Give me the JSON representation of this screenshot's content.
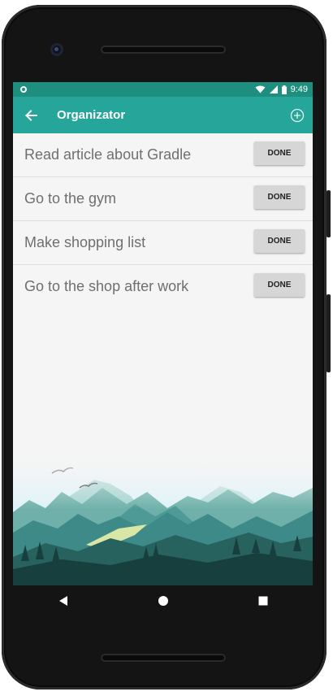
{
  "status_bar": {
    "time": "9:49"
  },
  "app_bar": {
    "title": "Organizator",
    "back_icon": "arrow-left-icon",
    "add_icon": "add-circle-icon"
  },
  "tasks": [
    {
      "label": "Read article about Gradle",
      "button": "DONE"
    },
    {
      "label": "Go to the gym",
      "button": "DONE"
    },
    {
      "label": "Make shopping list",
      "button": "DONE"
    },
    {
      "label": "Go to the shop after work",
      "button": "DONE"
    }
  ],
  "nav_bar": {
    "back": "back-triangle-icon",
    "home": "home-circle-icon",
    "recents": "recents-square-icon"
  },
  "colors": {
    "primary": "#26a69a",
    "primary_dark": "#1e8f7f",
    "background": "#f5f5f5",
    "button": "#d6d6d6",
    "task_text": "#6f6f6f"
  }
}
